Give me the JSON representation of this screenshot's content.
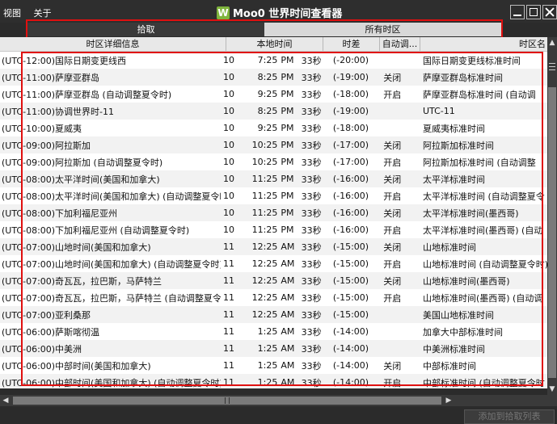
{
  "menu": {
    "view": "视图",
    "about": "关于"
  },
  "app": {
    "logo": "W",
    "title": "Moo0 世界时间查看器"
  },
  "tabs": [
    {
      "label": "拾取"
    },
    {
      "label": "所有时区"
    }
  ],
  "columns": {
    "name": "时区详细信息",
    "local": "本地时间",
    "offset": "时差",
    "dst": "自动调...",
    "std": "时区名"
  },
  "rows": [
    {
      "name": "(UTC-12:00)国际日期变更线西",
      "day": "10",
      "time": "7:25",
      "ampm": "PM",
      "sec": "33秒",
      "offset": "(-20:00)",
      "dst": "",
      "std": "国际日期变更线标准时间"
    },
    {
      "name": "(UTC-11:00)萨摩亚群岛",
      "day": "10",
      "time": "8:25",
      "ampm": "PM",
      "sec": "33秒",
      "offset": "(-19:00)",
      "dst": "关闭",
      "std": "萨摩亚群岛标准时间"
    },
    {
      "name": "(UTC-11:00)萨摩亚群岛 (自动调整夏令时)",
      "day": "10",
      "time": "9:25",
      "ampm": "PM",
      "sec": "33秒",
      "offset": "(-18:00)",
      "dst": "开启",
      "std": "萨摩亚群岛标准时间 (自动调"
    },
    {
      "name": "(UTC-11:00)协调世界时-11",
      "day": "10",
      "time": "8:25",
      "ampm": "PM",
      "sec": "33秒",
      "offset": "(-19:00)",
      "dst": "",
      "std": "UTC-11"
    },
    {
      "name": "(UTC-10:00)夏威夷",
      "day": "10",
      "time": "9:25",
      "ampm": "PM",
      "sec": "33秒",
      "offset": "(-18:00)",
      "dst": "",
      "std": "夏威夷标准时间"
    },
    {
      "name": "(UTC-09:00)阿拉斯加",
      "day": "10",
      "time": "10:25",
      "ampm": "PM",
      "sec": "33秒",
      "offset": "(-17:00)",
      "dst": "关闭",
      "std": "阿拉斯加标准时间"
    },
    {
      "name": "(UTC-09:00)阿拉斯加 (自动调整夏令时)",
      "day": "10",
      "time": "10:25",
      "ampm": "PM",
      "sec": "33秒",
      "offset": "(-17:00)",
      "dst": "开启",
      "std": "阿拉斯加标准时间 (自动调整"
    },
    {
      "name": "(UTC-08:00)太平洋时间(美国和加拿大)",
      "day": "10",
      "time": "11:25",
      "ampm": "PM",
      "sec": "33秒",
      "offset": "(-16:00)",
      "dst": "关闭",
      "std": "太平洋标准时间"
    },
    {
      "name": "(UTC-08:00)太平洋时间(美国和加拿大) (自动调整夏令时",
      "day": "10",
      "time": "11:25",
      "ampm": "PM",
      "sec": "33秒",
      "offset": "(-16:00)",
      "dst": "开启",
      "std": "太平洋标准时间 (自动调整夏令"
    },
    {
      "name": "(UTC-08:00)下加利福尼亚州",
      "day": "10",
      "time": "11:25",
      "ampm": "PM",
      "sec": "33秒",
      "offset": "(-16:00)",
      "dst": "关闭",
      "std": "太平洋标准时间(墨西哥)"
    },
    {
      "name": "(UTC-08:00)下加利福尼亚州 (自动调整夏令时)",
      "day": "10",
      "time": "11:25",
      "ampm": "PM",
      "sec": "33秒",
      "offset": "(-16:00)",
      "dst": "开启",
      "std": "太平洋标准时间(墨西哥) (自动"
    },
    {
      "name": "(UTC-07:00)山地时间(美国和加拿大)",
      "day": "11",
      "time": "12:25",
      "ampm": "AM",
      "sec": "33秒",
      "offset": "(-15:00)",
      "dst": "关闭",
      "std": "山地标准时间"
    },
    {
      "name": "(UTC-07:00)山地时间(美国和加拿大) (自动调整夏令时)",
      "day": "11",
      "time": "12:25",
      "ampm": "AM",
      "sec": "33秒",
      "offset": "(-15:00)",
      "dst": "开启",
      "std": "山地标准时间 (自动调整夏令时)"
    },
    {
      "name": "(UTC-07:00)奇瓦瓦，拉巴斯，马萨特兰",
      "day": "11",
      "time": "12:25",
      "ampm": "AM",
      "sec": "33秒",
      "offset": "(-15:00)",
      "dst": "关闭",
      "std": "山地标准时间(墨西哥)"
    },
    {
      "name": "(UTC-07:00)奇瓦瓦，拉巴斯，马萨特兰 (自动调整夏令时",
      "day": "11",
      "time": "12:25",
      "ampm": "AM",
      "sec": "33秒",
      "offset": "(-15:00)",
      "dst": "开启",
      "std": "山地标准时间(墨西哥) (自动调"
    },
    {
      "name": "(UTC-07:00)亚利桑那",
      "day": "11",
      "time": "12:25",
      "ampm": "AM",
      "sec": "33秒",
      "offset": "(-15:00)",
      "dst": "",
      "std": "美国山地标准时间"
    },
    {
      "name": "(UTC-06:00)萨斯喀彻温",
      "day": "11",
      "time": "1:25",
      "ampm": "AM",
      "sec": "33秒",
      "offset": "(-14:00)",
      "dst": "",
      "std": "加拿大中部标准时间"
    },
    {
      "name": "(UTC-06:00)中美洲",
      "day": "11",
      "time": "1:25",
      "ampm": "AM",
      "sec": "33秒",
      "offset": "(-14:00)",
      "dst": "",
      "std": "中美洲标准时间"
    },
    {
      "name": "(UTC-06:00)中部时间(美国和加拿大)",
      "day": "11",
      "time": "1:25",
      "ampm": "AM",
      "sec": "33秒",
      "offset": "(-14:00)",
      "dst": "关闭",
      "std": "中部标准时间"
    },
    {
      "name": "(UTC-06:00)中部时间(美国和加拿大) (自动调整夏令时)",
      "day": "11",
      "time": "1:25",
      "ampm": "AM",
      "sec": "33秒",
      "offset": "(-14:00)",
      "dst": "开启",
      "std": "中部标准时间 (自动调整夏令时"
    }
  ],
  "buttons": {
    "add": "添加到拾取列表"
  }
}
